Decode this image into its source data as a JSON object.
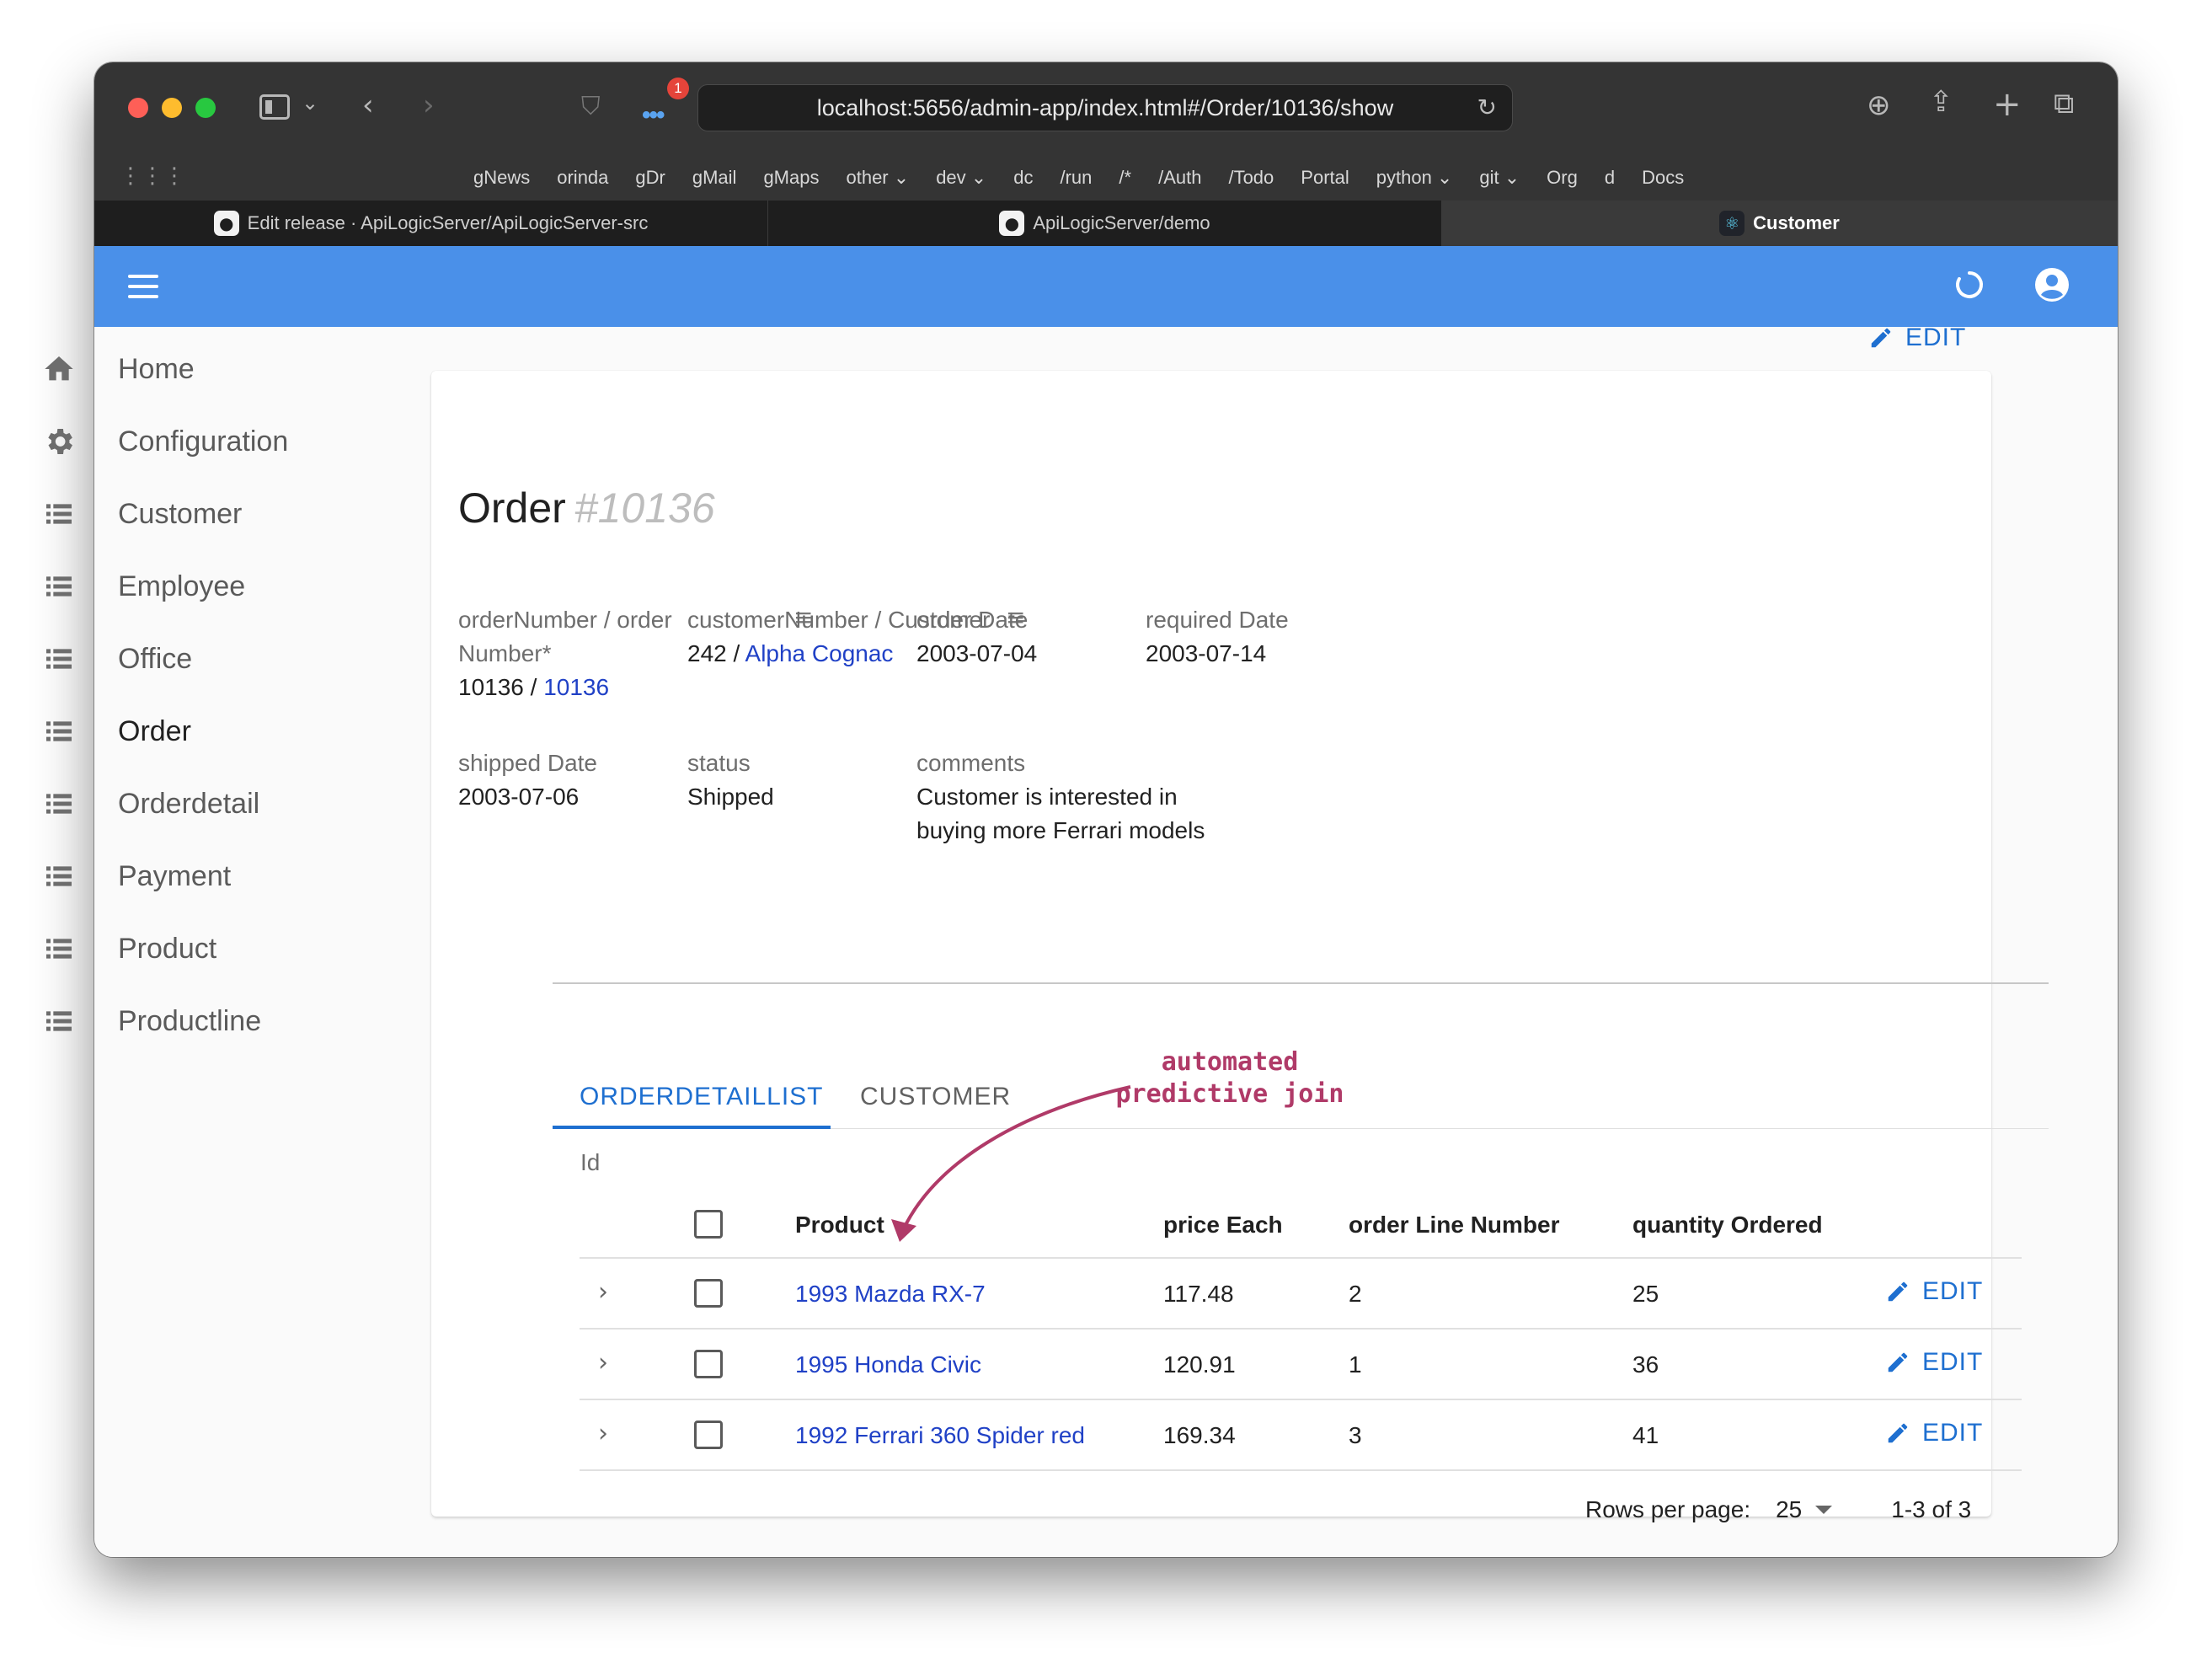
{
  "browser": {
    "url": "localhost:5656/admin-app/index.html#/Order/10136/show",
    "notification_count": "1",
    "bookmarks": [
      "gNews",
      "orinda",
      "gDr",
      "gMail",
      "gMaps",
      "other ⌄",
      "dev ⌄",
      "dc",
      "/run",
      "/*",
      "/Auth",
      "/Todo",
      "Portal",
      "python ⌄",
      "git ⌄",
      "Org",
      "d",
      "Docs"
    ],
    "tabs": [
      {
        "title": "Edit release · ApiLogicServer/ApiLogicServer-src",
        "icon": "github-icon"
      },
      {
        "title": "ApiLogicServer/demo",
        "icon": "github-icon"
      },
      {
        "title": "Customer",
        "icon": "react-icon"
      }
    ]
  },
  "sidebar": {
    "items": [
      {
        "label": "Home",
        "icon": "home-icon"
      },
      {
        "label": "Configuration",
        "icon": "gear-icon"
      },
      {
        "label": "Customer",
        "icon": "list-icon"
      },
      {
        "label": "Employee",
        "icon": "list-icon"
      },
      {
        "label": "Office",
        "icon": "list-icon"
      },
      {
        "label": "Order",
        "icon": "list-icon"
      },
      {
        "label": "Orderdetail",
        "icon": "list-icon"
      },
      {
        "label": "Payment",
        "icon": "list-icon"
      },
      {
        "label": "Product",
        "icon": "list-icon"
      },
      {
        "label": "Productline",
        "icon": "list-icon"
      }
    ],
    "active": "Order"
  },
  "page": {
    "edit_label": "EDIT",
    "title": "Order",
    "title_id": "#10136"
  },
  "fields": {
    "order_number": {
      "label": "orderNumber / order Number*",
      "value_plain": "10136 / ",
      "value_link": "10136"
    },
    "customer_number": {
      "label": "customerNumber / Customer",
      "value_plain": "242 / ",
      "value_link": "Alpha Cognac"
    },
    "order_date": {
      "label": "order Date",
      "value": "2003-07-04"
    },
    "required_date": {
      "label": "required Date",
      "value": "2003-07-14"
    },
    "shipped_date": {
      "label": "shipped Date",
      "value": "2003-07-06"
    },
    "status": {
      "label": "status",
      "value": "Shipped"
    },
    "comments": {
      "label": "comments",
      "value": "Customer is interested in buying more Ferrari models"
    }
  },
  "tabs": [
    "ORDERDETAILLIST",
    "CUSTOMER"
  ],
  "detail": {
    "id_label": "Id",
    "columns": [
      "Product",
      "price Each",
      "order Line Number",
      "quantity Ordered"
    ],
    "rows": [
      {
        "product": "1993 Mazda RX-7",
        "price_each": "117.48",
        "order_line_number": "2",
        "quantity_ordered": "25",
        "edit": "EDIT"
      },
      {
        "product": "1995 Honda Civic",
        "price_each": "120.91",
        "order_line_number": "1",
        "quantity_ordered": "36",
        "edit": "EDIT"
      },
      {
        "product": "1992 Ferrari 360 Spider red",
        "price_each": "169.34",
        "order_line_number": "3",
        "quantity_ordered": "41",
        "edit": "EDIT"
      }
    ],
    "rows_per_page_label": "Rows per page:",
    "rows_per_page": "25",
    "range": "1-3 of 3"
  },
  "annotation": {
    "line1": "automated",
    "line2": "predictive join"
  },
  "colors": {
    "appbar": "#4a90e9",
    "accent": "#1e6fd0",
    "link": "#2041c6",
    "annotation": "#b03a68"
  }
}
